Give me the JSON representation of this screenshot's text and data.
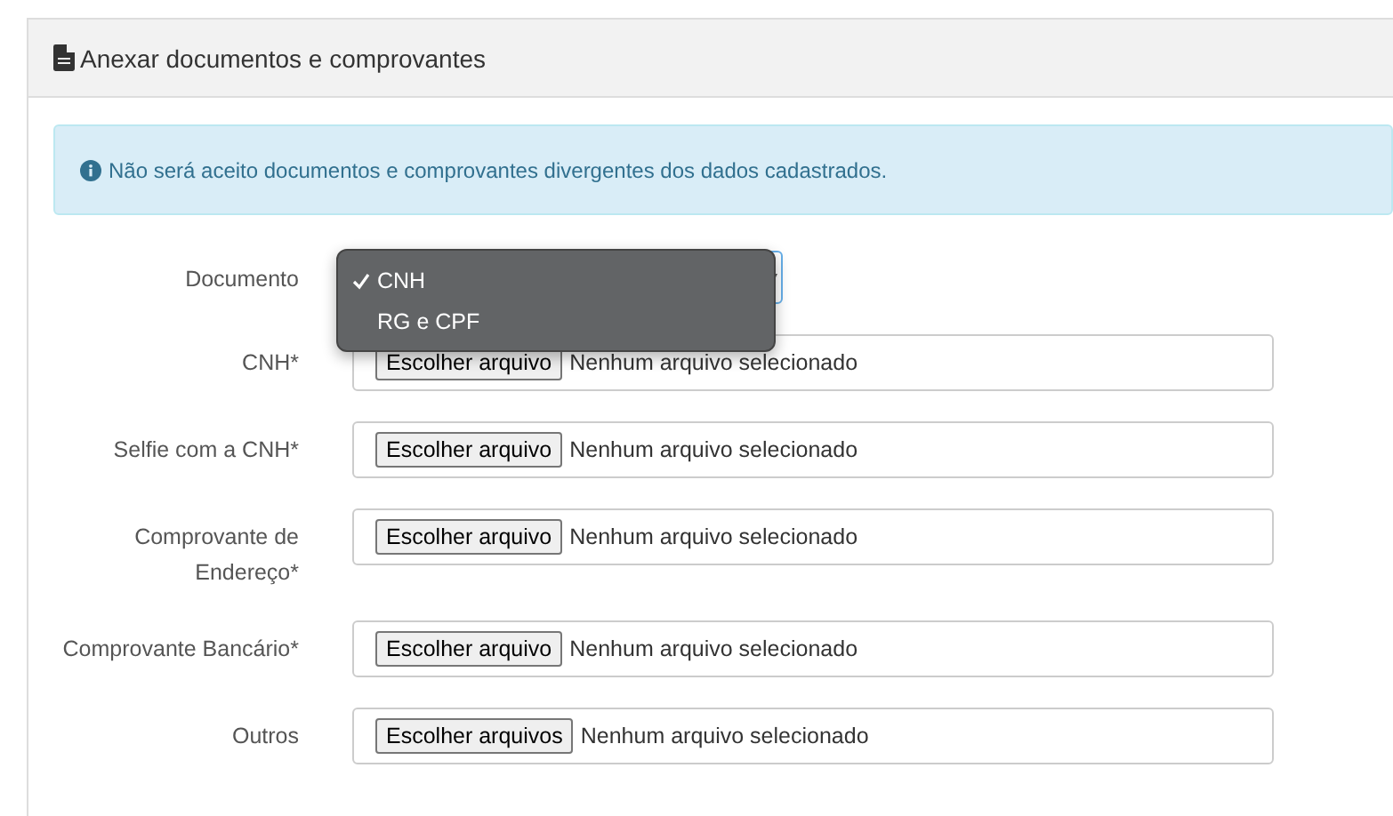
{
  "panel": {
    "title": "Anexar documentos e comprovantes"
  },
  "alert": {
    "text": "Não será aceito documentos e comprovantes divergentes dos dados cadastrados."
  },
  "document_select": {
    "label": "Documento",
    "expanded": true,
    "options": [
      {
        "label": "CNH",
        "selected": true
      },
      {
        "label": "RG e CPF",
        "selected": false
      }
    ]
  },
  "file_fields": [
    {
      "label": "CNH*",
      "button": "Escolher arquivo",
      "status": "Nenhum arquivo selecionado"
    },
    {
      "label": "Selfie com a CNH*",
      "button": "Escolher arquivo",
      "status": "Nenhum arquivo selecionado"
    },
    {
      "label": "Comprovante de Endereço*",
      "button": "Escolher arquivo",
      "status": "Nenhum arquivo selecionado"
    },
    {
      "label": "Comprovante Bancário*",
      "button": "Escolher arquivo",
      "status": "Nenhum arquivo selecionado"
    },
    {
      "label": "Outros",
      "button": "Escolher arquivos",
      "status": "Nenhum arquivo selecionado"
    }
  ]
}
